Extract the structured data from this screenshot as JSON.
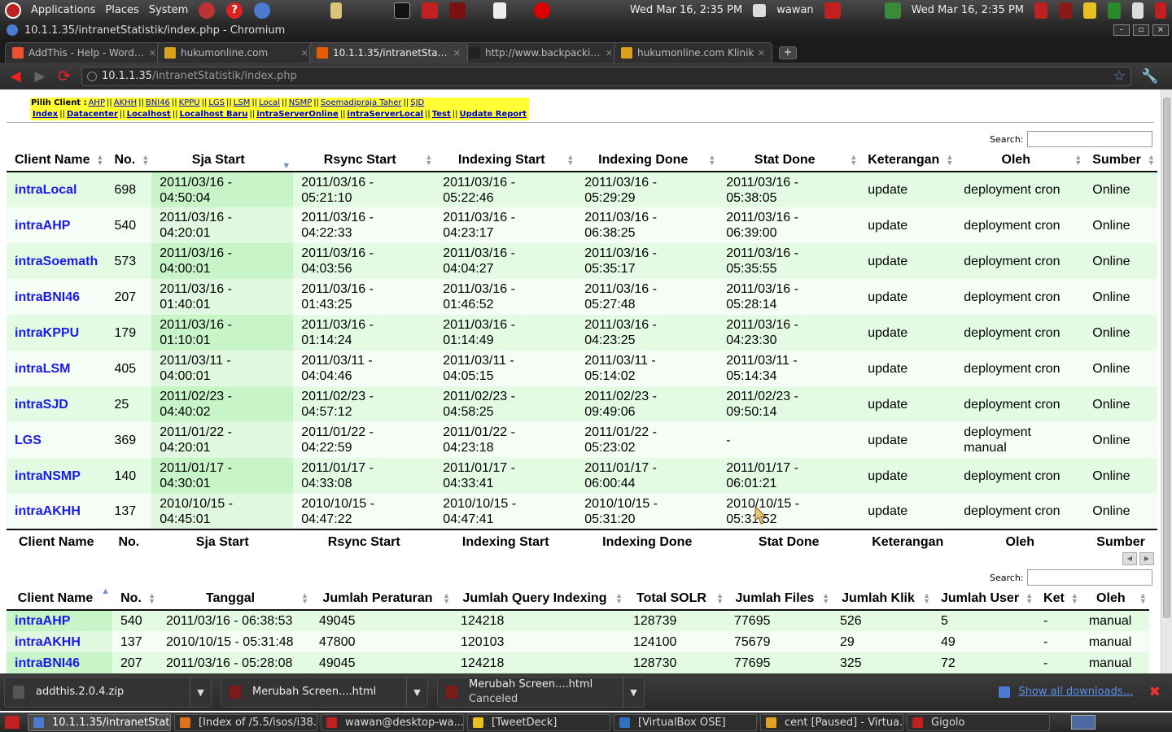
{
  "top_panel": {
    "menus": [
      "Applications",
      "Places",
      "System"
    ],
    "clock_left": "Wed Mar 16,  2:35 PM",
    "user": "wawan",
    "clock_right": "Wed Mar 16,  2:35 PM"
  },
  "window": {
    "title": "10.1.1.35/intranetStatistik/index.php - Chromium",
    "buttons": [
      "–",
      "▫",
      "×"
    ]
  },
  "tabs": [
    {
      "title": "AddThis - Help - WordP...",
      "favicon": "addthis-icon",
      "color": "#f05030"
    },
    {
      "title": "hukumonline.com",
      "favicon": "hukumonline-icon",
      "color": "#d9a21a"
    },
    {
      "title": "10.1.1.35/intranetStatisti...",
      "favicon": "page-icon",
      "color": "#e85d00",
      "active": true
    },
    {
      "title": "http://www.backpackinm...",
      "favicon": "blank-page-icon",
      "color": "#222"
    },
    {
      "title": "hukumonline.com Klinik",
      "favicon": "hukumonline-icon",
      "color": "#d9a21a"
    }
  ],
  "address": {
    "host": "10.1.1.35",
    "path": "/intranetStatistik/index.php"
  },
  "client_menu": {
    "label": "Pilih Client :",
    "clients": [
      "AHP",
      "AKHH",
      "BNI46",
      "KPPU",
      "LGS",
      "LSM",
      "Local",
      "NSMP",
      "Soemadipraja Taher",
      "SJD"
    ],
    "links": [
      "Index",
      "Datacenter",
      "Localhost",
      "Localhost Baru",
      "intraServerOnline",
      "intraServerLocal",
      "Test",
      "Update Report"
    ]
  },
  "search_label": "Search:",
  "table1": {
    "headers": [
      "Client Name",
      "No.",
      "Sja Start",
      "Rsync Start",
      "Indexing Start",
      "Indexing Done",
      "Stat Done",
      "Keterangan",
      "Oleh",
      "Sumber"
    ],
    "rows": [
      [
        "intraLocal",
        "698",
        "2011/03/16 - 04:50:04",
        "2011/03/16 - 05:21:10",
        "2011/03/16 - 05:22:46",
        "2011/03/16 - 05:29:29",
        "2011/03/16 - 05:38:05",
        "update",
        "deployment cron",
        "Online"
      ],
      [
        "intraAHP",
        "540",
        "2011/03/16 - 04:20:01",
        "2011/03/16 - 04:22:33",
        "2011/03/16 - 04:23:17",
        "2011/03/16 - 06:38:25",
        "2011/03/16 - 06:39:00",
        "update",
        "deployment cron",
        "Online"
      ],
      [
        "intraSoemath",
        "573",
        "2011/03/16 - 04:00:01",
        "2011/03/16 - 04:03:56",
        "2011/03/16 - 04:04:27",
        "2011/03/16 - 05:35:17",
        "2011/03/16 - 05:35:55",
        "update",
        "deployment cron",
        "Online"
      ],
      [
        "intraBNI46",
        "207",
        "2011/03/16 - 01:40:01",
        "2011/03/16 - 01:43:25",
        "2011/03/16 - 01:46:52",
        "2011/03/16 - 05:27:48",
        "2011/03/16 - 05:28:14",
        "update",
        "deployment cron",
        "Online"
      ],
      [
        "intraKPPU",
        "179",
        "2011/03/16 - 01:10:01",
        "2011/03/16 - 01:14:24",
        "2011/03/16 - 01:14:49",
        "2011/03/16 - 04:23:25",
        "2011/03/16 - 04:23:30",
        "update",
        "deployment cron",
        "Online"
      ],
      [
        "intraLSM",
        "405",
        "2011/03/11 - 04:00:01",
        "2011/03/11 - 04:04:46",
        "2011/03/11 - 04:05:15",
        "2011/03/11 - 05:14:02",
        "2011/03/11 - 05:14:34",
        "update",
        "deployment cron",
        "Online"
      ],
      [
        "intraSJD",
        "25",
        "2011/02/23 - 04:40:02",
        "2011/02/23 - 04:57:12",
        "2011/02/23 - 04:58:25",
        "2011/02/23 - 09:49:06",
        "2011/02/23 - 09:50:14",
        "update",
        "deployment cron",
        "Online"
      ],
      [
        "LGS",
        "369",
        "2011/01/22 - 04:20:01",
        "2011/01/22 - 04:22:59",
        "2011/01/22 - 04:23:18",
        "2011/01/22 - 05:23:02",
        "-",
        "update",
        "deployment manual",
        "Online"
      ],
      [
        "intraNSMP",
        "140",
        "2011/01/17 - 04:30:01",
        "2011/01/17 - 04:33:08",
        "2011/01/17 - 04:33:41",
        "2011/01/17 - 06:00:44",
        "2011/01/17 - 06:01:21",
        "update",
        "deployment cron",
        "Online"
      ],
      [
        "intraAKHH",
        "137",
        "2010/10/15 - 04:45:01",
        "2010/10/15 - 04:47:22",
        "2010/10/15 - 04:47:41",
        "2010/10/15 - 05:31:20",
        "2010/10/15 - 05:31:52",
        "update",
        "deployment cron",
        "Online"
      ]
    ]
  },
  "table2": {
    "headers": [
      "Client Name",
      "No.",
      "Tanggal",
      "Jumlah Peraturan",
      "Jumlah Query Indexing",
      "Total SOLR",
      "Jumlah Files",
      "Jumlah Klik",
      "Jumlah User",
      "Ket",
      "Oleh"
    ],
    "rows": [
      [
        "intraAHP",
        "540",
        "2011/03/16 - 06:38:53",
        "49045",
        "124218",
        "128739",
        "77695",
        "526",
        "5",
        "-",
        "manual"
      ],
      [
        "intraAKHH",
        "137",
        "2010/10/15 - 05:31:48",
        "47800",
        "120103",
        "124100",
        "75679",
        "29",
        "49",
        "-",
        "manual"
      ],
      [
        "intraBNI46",
        "207",
        "2011/03/16 - 05:28:08",
        "49045",
        "124218",
        "128730",
        "77695",
        "325",
        "72",
        "-",
        "manual"
      ]
    ]
  },
  "downloads": [
    {
      "name": "addthis.2.0.4.zip",
      "status": ""
    },
    {
      "name": "Merubah Screen....html",
      "status": ""
    },
    {
      "name": "Merubah Screen....html",
      "status": "Canceled"
    }
  ],
  "show_all_downloads": "Show all downloads...",
  "taskbar": [
    {
      "label": "10.1.1.35/intranetStat...",
      "icon": "chromium-icon",
      "color": "#4a7bd0",
      "active": true
    },
    {
      "label": "[Index of /5.5/isos/i38...",
      "icon": "firefox-icon",
      "color": "#e07020"
    },
    {
      "label": "wawan@desktop-wa...",
      "icon": "terminal-icon",
      "color": "#c02020"
    },
    {
      "label": "[TweetDeck]",
      "icon": "tweetdeck-icon",
      "color": "#e8c020"
    },
    {
      "label": "[VirtualBox OSE]",
      "icon": "virtualbox-icon",
      "color": "#3070c0"
    },
    {
      "label": "cent [Paused] - Virtua...",
      "icon": "virtualbox-vm-icon",
      "color": "#e0a020"
    },
    {
      "label": "Gigolo",
      "icon": "gigolo-icon",
      "color": "#c02020"
    }
  ],
  "colors": {
    "menu_bg": "#ffff33",
    "row_odd": "#e3fbe3",
    "row_even": "#f6fdf6",
    "sorted_col": "#c7f5c7",
    "client_link": "#1a1ae6"
  }
}
